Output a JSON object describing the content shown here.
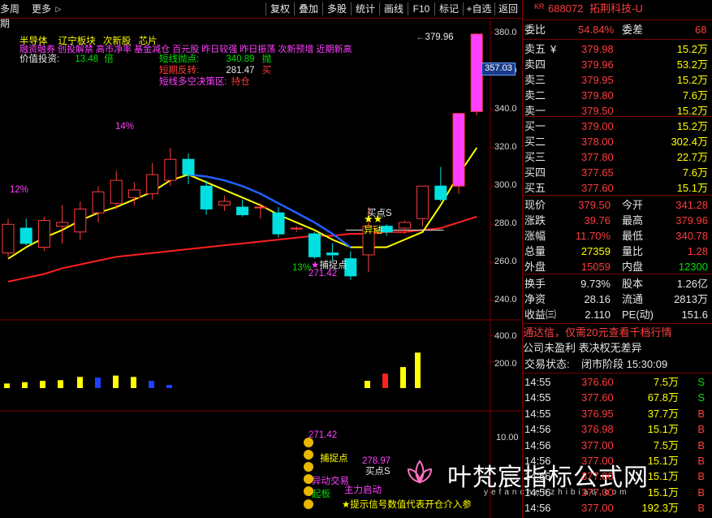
{
  "toolbar": {
    "left_label": "多周期",
    "more_label": "更多",
    "more_arrow": "▷",
    "buttons": [
      "复权",
      "叠加",
      "多股",
      "统计",
      "画线",
      "F10",
      "标记",
      "+自选",
      "返回"
    ]
  },
  "price_axis": {
    "ticks": [
      "380.0",
      "360.0",
      "340.0",
      "320.0",
      "300.0",
      "280.0",
      "260.0",
      "240.0"
    ],
    "current_tag": "357.03"
  },
  "volume_axis": {
    "ticks": [
      "400.0",
      "200.0"
    ]
  },
  "indicator_axis": {
    "ticks": [
      "10.00"
    ]
  },
  "legend": {
    "line1": [
      "半导体",
      "辽宁板块",
      "次新股",
      "芯片"
    ],
    "line2": "融资融券 创投解禁 高市净率 基金减仓 百元股 昨日较强 昨日振荡 次新预增 近期新高",
    "value_label": "价值投资:",
    "value_num": "13.48",
    "value_unit": "倍",
    "short_rows": [
      {
        "label": "短线抛点:",
        "value": "340.89",
        "signal": "抛"
      },
      {
        "label": "短期反转:",
        "value": "281.47",
        "signal": "买"
      }
    ],
    "strategy_label": "短线多空决策区:",
    "strategy_value": "持仓"
  },
  "annotations": {
    "pct_12": "12%",
    "pct_14": "14%",
    "pct_13": "13%",
    "high_price": "379.96",
    "low_price": "271.42",
    "catch_point": "捕捉点",
    "buy_point": "买点S",
    "diff_move": "异动",
    "sub_low": "271.42",
    "sub_catch": "捕捉点",
    "sub_move": "异动交易",
    "sub_start": "起板",
    "sub_buy_price": "278.97",
    "sub_buy": "买点S",
    "sub_main": "主力启动",
    "sub_tip": "★提示信号数值代表开仓介入参"
  },
  "watermark": {
    "title": "叶梵宸指标公式网",
    "url": "yefanchenzhibiao.com"
  },
  "chart_data": {
    "type": "candlestick",
    "candles": [
      {
        "o": 265,
        "h": 283,
        "l": 263,
        "c": 280,
        "up": true
      },
      {
        "o": 278,
        "h": 283,
        "l": 269,
        "c": 270,
        "up": false
      },
      {
        "o": 268,
        "h": 284,
        "l": 266,
        "c": 282,
        "up": true
      },
      {
        "o": 281,
        "h": 290,
        "l": 270,
        "c": 279,
        "up": true
      },
      {
        "o": 276,
        "h": 292,
        "l": 272,
        "c": 288,
        "up": true
      },
      {
        "o": 286,
        "h": 300,
        "l": 281,
        "c": 297,
        "up": true
      },
      {
        "o": 291,
        "h": 308,
        "l": 288,
        "c": 303,
        "up": true
      },
      {
        "o": 294,
        "h": 302,
        "l": 290,
        "c": 298,
        "up": true
      },
      {
        "o": 296,
        "h": 312,
        "l": 293,
        "c": 306,
        "up": true
      },
      {
        "o": 303,
        "h": 320,
        "l": 300,
        "c": 314,
        "up": true
      },
      {
        "o": 314,
        "h": 317,
        "l": 301,
        "c": 306,
        "up": false
      },
      {
        "o": 300,
        "h": 303,
        "l": 285,
        "c": 288,
        "up": false
      },
      {
        "o": 290,
        "h": 295,
        "l": 287,
        "c": 292,
        "up": true
      },
      {
        "o": 289,
        "h": 293,
        "l": 284,
        "c": 285,
        "up": false
      },
      {
        "o": 289,
        "h": 291,
        "l": 283,
        "c": 289,
        "up": true
      },
      {
        "o": 286,
        "h": 289,
        "l": 273,
        "c": 275,
        "up": false
      },
      {
        "o": 278,
        "h": 279,
        "l": 276,
        "c": 278,
        "up": true
      },
      {
        "o": 275,
        "h": 276,
        "l": 262,
        "c": 263,
        "up": false
      },
      {
        "o": 265,
        "h": 270,
        "l": 261,
        "c": 264,
        "up": false
      },
      {
        "o": 262,
        "h": 266,
        "l": 251,
        "c": 253,
        "up": false
      },
      {
        "o": 264,
        "h": 289,
        "l": 255,
        "c": 279,
        "up": true
      },
      {
        "o": 276,
        "h": 280,
        "l": 274,
        "c": 279,
        "up": false
      },
      {
        "o": 278,
        "h": 282,
        "l": 275,
        "c": 281,
        "up": true
      },
      {
        "o": 283,
        "h": 300,
        "l": 279,
        "c": 300,
        "up": true
      },
      {
        "o": 300,
        "h": 310,
        "l": 292,
        "c": 293,
        "up": false
      },
      {
        "o": 300,
        "h": 338,
        "l": 296,
        "c": 338,
        "up": true
      },
      {
        "o": 339,
        "h": 380,
        "l": 337,
        "c": 379.5,
        "up": true
      }
    ],
    "ma_yellow": [
      262,
      268,
      273,
      277,
      282,
      286,
      289,
      293,
      297,
      303,
      306,
      302,
      298,
      294,
      290,
      285,
      281,
      277,
      272,
      268,
      268,
      268,
      272,
      276,
      290,
      306,
      320
    ],
    "ma_blue": [
      null,
      null,
      null,
      null,
      null,
      null,
      null,
      null,
      null,
      null,
      306,
      305,
      303,
      300,
      296,
      291,
      286,
      281,
      275,
      268,
      null,
      null,
      null,
      null,
      null,
      null,
      null
    ],
    "ma_red": [
      250,
      252,
      254,
      257,
      259,
      261,
      263,
      264,
      265,
      266,
      267,
      268,
      269,
      270,
      271,
      272,
      273,
      274,
      274,
      275,
      275,
      276,
      276,
      277,
      278,
      281,
      284
    ],
    "volume": [
      {
        "v": 35,
        "c": "yellow"
      },
      {
        "v": 45,
        "c": "yellow"
      },
      {
        "v": 55,
        "c": "yellow"
      },
      {
        "v": 60,
        "c": "yellow"
      },
      {
        "v": 85,
        "c": "yellow"
      },
      {
        "v": 80,
        "c": "blue"
      },
      {
        "v": 95,
        "c": "yellow"
      },
      {
        "v": 85,
        "c": "yellow"
      },
      {
        "v": 55,
        "c": "blue"
      },
      {
        "v": 25,
        "c": "blue"
      },
      {
        "v": 55,
        "c": "yellow"
      },
      {
        "v": 110,
        "c": "red"
      },
      {
        "v": 160,
        "c": "yellow"
      },
      {
        "v": 270,
        "c": "yellow"
      }
    ],
    "ylim": [
      230,
      388
    ],
    "vol_ylim": [
      0,
      420
    ]
  },
  "panel": {
    "code": "688072",
    "name": "拓荆科技-U",
    "kr": "KR",
    "weibi_label": "委比",
    "weibi_value": "54.84%",
    "weicha_label": "委差",
    "weicha_value": "68",
    "asks": [
      {
        "label": "卖五",
        "extra": "¥",
        "price": "379.98",
        "vol": "15.2万"
      },
      {
        "label": "卖四",
        "extra": "",
        "price": "379.96",
        "vol": "53.2万"
      },
      {
        "label": "卖三",
        "extra": "",
        "price": "379.95",
        "vol": "15.2万"
      },
      {
        "label": "卖二",
        "extra": "",
        "price": "379.80",
        "vol": "7.6万"
      },
      {
        "label": "卖一",
        "extra": "",
        "price": "379.50",
        "vol": "15.2万"
      }
    ],
    "bids": [
      {
        "label": "买一",
        "price": "379.00",
        "vol": "15.2万"
      },
      {
        "label": "买二",
        "price": "378.00",
        "vol": "302.4万"
      },
      {
        "label": "买三",
        "price": "377.80",
        "vol": "22.7万"
      },
      {
        "label": "买四",
        "price": "377.65",
        "vol": "7.6万"
      },
      {
        "label": "买五",
        "price": "377.60",
        "vol": "15.1万"
      }
    ],
    "quote": [
      {
        "l1": "现价",
        "v1": "379.50",
        "c1": "red",
        "l2": "今开",
        "v2": "341.28",
        "c2": "red"
      },
      {
        "l1": "涨跌",
        "v1": "39.76",
        "c1": "red",
        "l2": "最高",
        "v2": "379.96",
        "c2": "red"
      },
      {
        "l1": "涨幅",
        "v1": "11.70%",
        "c1": "red",
        "l2": "最低",
        "v2": "340.78",
        "c2": "red"
      },
      {
        "l1": "总量",
        "v1": "27359",
        "c1": "yellow",
        "l2": "量比",
        "v2": "1.28",
        "c2": "red"
      },
      {
        "l1": "外盘",
        "v1": "15059",
        "c1": "red",
        "l2": "内盘",
        "v2": "12300",
        "c2": "green"
      }
    ],
    "finance": [
      {
        "l1": "换手",
        "v1": "9.73%",
        "l2": "股本",
        "v2": "1.26亿"
      },
      {
        "l1": "净资",
        "v1": "28.16",
        "l2": "流通",
        "v2": "2813万"
      },
      {
        "l1": "收益㈢",
        "v1": "2.110",
        "l2": "PE(动)",
        "v2": "151.6"
      }
    ],
    "ad": "通达信，仅需20元查看千档行情",
    "notice": "公司未盈利 表决权无差异",
    "status_label": "交易状态:",
    "status_value": "闭市阶段 15:30:09",
    "ticks": [
      {
        "t": "14:55",
        "p": "376.60",
        "v": "7.5万",
        "s": "S"
      },
      {
        "t": "14:55",
        "p": "377.60",
        "v": "67.8万",
        "s": "S"
      },
      {
        "t": "14:55",
        "p": "376.95",
        "v": "37.7万",
        "s": "B"
      },
      {
        "t": "14:56",
        "p": "376.98",
        "v": "15.1万",
        "s": "B"
      },
      {
        "t": "14:56",
        "p": "377.00",
        "v": "7.5万",
        "s": "B"
      },
      {
        "t": "14:56",
        "p": "377.00",
        "v": "15.1万",
        "s": "B"
      },
      {
        "t": "14:56",
        "p": "377.00",
        "v": "15.1万",
        "s": "B"
      },
      {
        "t": "14:56",
        "p": "377.00",
        "v": "15.1万",
        "s": "B"
      },
      {
        "t": "14:56",
        "p": "377.00",
        "v": "192.3万",
        "s": "B"
      }
    ]
  }
}
